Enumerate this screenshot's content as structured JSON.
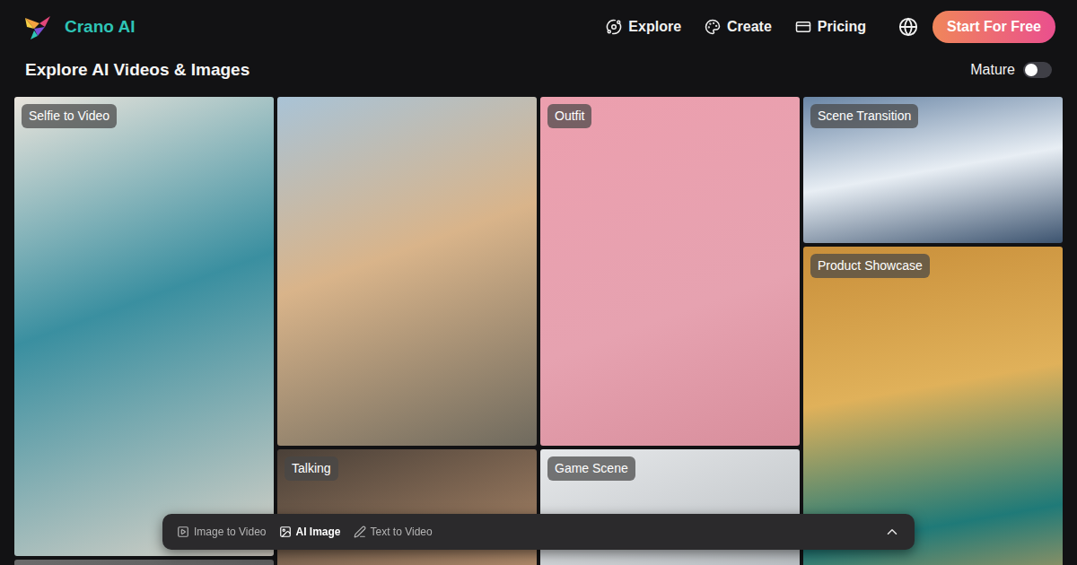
{
  "header": {
    "logo": "Crano AI",
    "nav": [
      {
        "label": "Explore"
      },
      {
        "label": "Create"
      },
      {
        "label": "Pricing"
      }
    ],
    "cta": "Start For Free"
  },
  "page": {
    "title": "Explore AI Videos & Images",
    "mature": {
      "label": "Mature",
      "on": false
    }
  },
  "gallery": {
    "columns": [
      [
        {
          "label": "Selfie to Video"
        },
        {
          "label": ""
        }
      ],
      [
        {
          "label": ""
        },
        {
          "label": "Talking"
        }
      ],
      [
        {
          "label": "Outfit"
        },
        {
          "label": "Game Scene"
        }
      ],
      [
        {
          "label": "Scene Transition"
        },
        {
          "label": "Product Showcase"
        }
      ]
    ]
  },
  "toolbar": {
    "modes": [
      {
        "label": "Image to Video",
        "selected": false
      },
      {
        "label": "AI Image",
        "selected": true
      },
      {
        "label": "Text to Video",
        "selected": false
      }
    ],
    "expanded": false
  }
}
